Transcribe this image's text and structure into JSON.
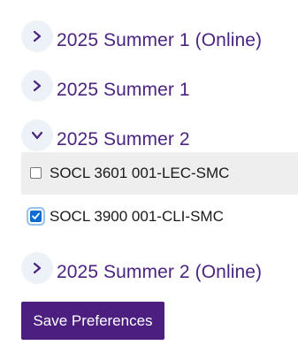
{
  "terms": [
    {
      "label": "2025 Summer 1 (Online)",
      "expanded": false
    },
    {
      "label": "2025 Summer 1",
      "expanded": false
    },
    {
      "label": "2025 Summer 2",
      "expanded": true,
      "courses": [
        {
          "label": "SOCL 3601 001-LEC-SMC",
          "checked": false
        },
        {
          "label": "SOCL 3900 001-CLI-SMC",
          "checked": true
        }
      ]
    },
    {
      "label": "2025 Summer 2 (Online)",
      "expanded": false
    }
  ],
  "icons": {
    "collapsed": "chevron-right-icon",
    "expanded": "chevron-down-icon"
  },
  "colors": {
    "accent": "#4b1e7f",
    "term_text": "#4a2480",
    "toggle_bg": "#edf1f8",
    "checkbox_checked": "#0b6bd1",
    "row_shade": "#eeeeee"
  },
  "save_button": {
    "label": "Save Preferences"
  }
}
